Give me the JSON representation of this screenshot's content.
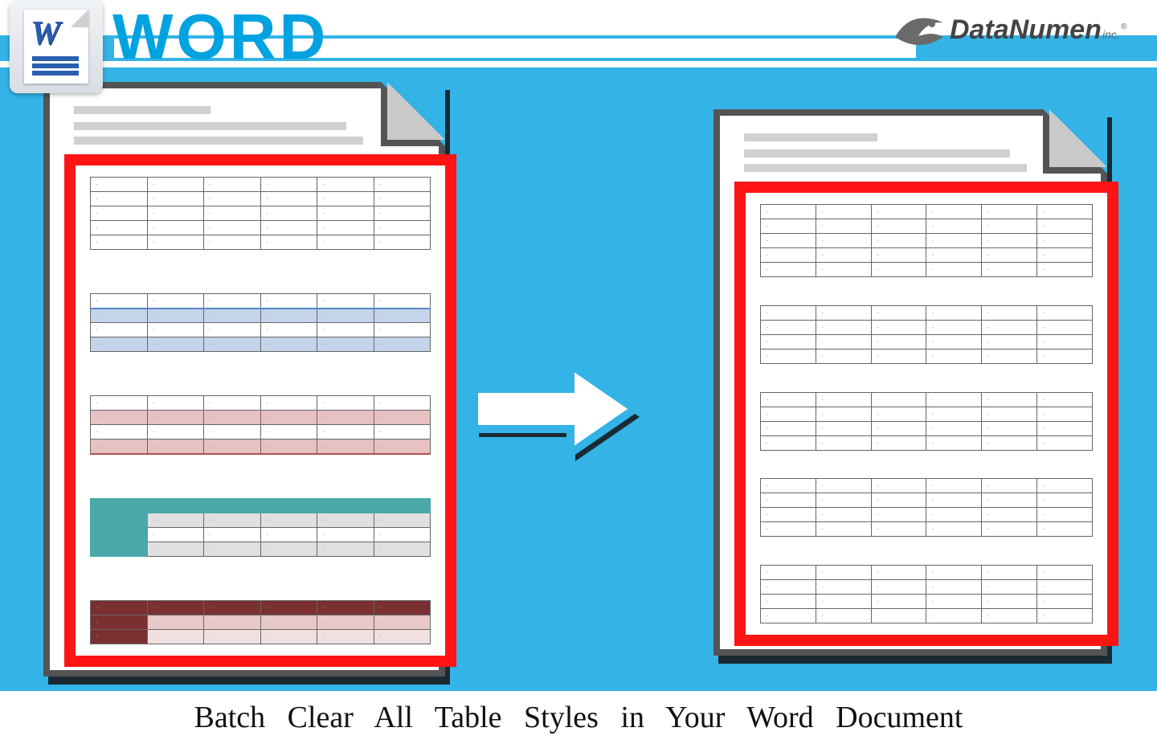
{
  "header": {
    "word_label": "WORD",
    "word_icon_letter": "W",
    "brand_main": "DataNumen",
    "brand_suffix": "inc."
  },
  "caption": "Batch Clear All Table Styles in Your Word Document",
  "left_doc": {
    "tables": [
      {
        "style": "style-plain",
        "rows": 5,
        "cols": 6
      },
      {
        "style": "style-blue",
        "rows": 4,
        "cols": 6
      },
      {
        "style": "style-pink",
        "rows": 4,
        "cols": 6
      },
      {
        "style": "style-teal",
        "rows": 4,
        "cols": 6
      },
      {
        "style": "style-maroon",
        "rows": 3,
        "cols": 6
      }
    ]
  },
  "right_doc": {
    "tables": [
      {
        "style": "style-plain",
        "rows": 5,
        "cols": 6
      },
      {
        "style": "style-plain",
        "rows": 4,
        "cols": 6
      },
      {
        "style": "style-plain",
        "rows": 4,
        "cols": 6
      },
      {
        "style": "style-plain",
        "rows": 4,
        "cols": 6
      },
      {
        "style": "style-plain",
        "rows": 4,
        "cols": 6
      }
    ]
  },
  "colors": {
    "cyan": "#33b3e6",
    "red_frame": "#ff1414",
    "doc_border": "#545454"
  }
}
